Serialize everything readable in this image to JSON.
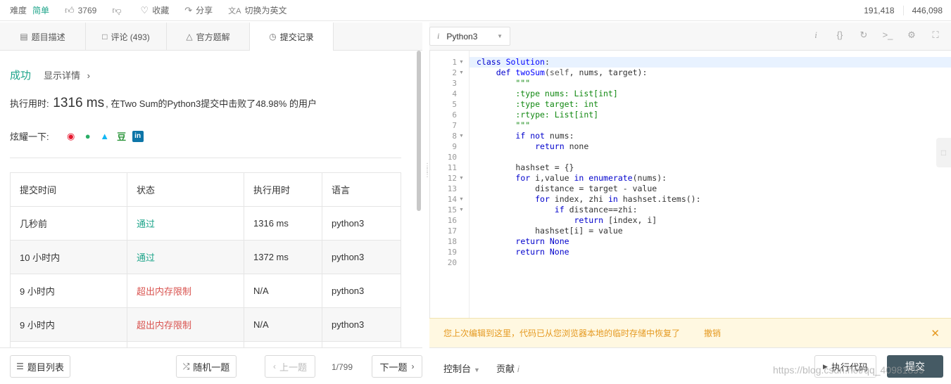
{
  "topbar": {
    "difficulty_label": "难度",
    "difficulty_value": "简单",
    "likes": "3769",
    "favorite": "收藏",
    "share": "分享",
    "switch_lang": "切换为英文",
    "stat1": "191,418",
    "stat2": "446,098"
  },
  "tabs": [
    {
      "label": "题目描述",
      "icon": "document-icon"
    },
    {
      "label": "评论 (493)",
      "icon": "comment-icon"
    },
    {
      "label": "官方题解",
      "icon": "flask-icon"
    },
    {
      "label": "提交记录",
      "icon": "clock-icon",
      "active": true
    }
  ],
  "result": {
    "status": "成功",
    "details": "显示详情",
    "runtime_prefix": "执行用时:",
    "runtime_value": "1316 ms",
    "runtime_suffix": ", 在Two Sum的Python3提交中击败了48.98% 的用户",
    "share_label": "炫耀一下:"
  },
  "share_icons": [
    "weibo-icon",
    "wechat-icon",
    "qq-icon",
    "douban-icon",
    "linkedin-icon"
  ],
  "submissions": {
    "headers": [
      "提交时间",
      "状态",
      "执行用时",
      "语言"
    ],
    "rows": [
      {
        "time": "几秒前",
        "status": "通过",
        "ok": true,
        "runtime": "1316 ms",
        "lang": "python3"
      },
      {
        "time": "10 小时内",
        "status": "通过",
        "ok": true,
        "runtime": "1372 ms",
        "lang": "python3"
      },
      {
        "time": "9 小时内",
        "status": "超出内存限制",
        "ok": false,
        "runtime": "N/A",
        "lang": "python3"
      },
      {
        "time": "9 小时内",
        "status": "超出内存限制",
        "ok": false,
        "runtime": "N/A",
        "lang": "python3"
      }
    ]
  },
  "footer_left": {
    "problem_list": "题目列表",
    "random": "随机一题",
    "prev": "上一题",
    "page": "1/799",
    "next": "下一题"
  },
  "editor": {
    "language": "Python3",
    "lines": [
      "class Solution:",
      "    def twoSum(self, nums, target):",
      "        \"\"\"",
      "        :type nums: List[int]",
      "        :type target: int",
      "        :rtype: List[int]",
      "        \"\"\"",
      "        if not nums:",
      "            return none",
      "",
      "        hashset = {}",
      "        for i,value in enumerate(nums):",
      "            distance = target - value",
      "            for index, zhi in hashset.items():",
      "                if distance==zhi:",
      "                    return [index, i]",
      "            hashset[i] = value",
      "        return None",
      "        return None",
      ""
    ],
    "fold_lines": [
      1,
      2,
      8,
      12,
      14,
      15
    ]
  },
  "restore": {
    "message": "您上次编辑到这里，代码已从您浏览器本地的临时存储中恢复了",
    "undo": "撤销"
  },
  "footer_right": {
    "console": "控制台",
    "contribute": "贡献",
    "run": "执行代码",
    "submit": "提交"
  },
  "watermark": "https://blog.csdn.net/qq_40981899"
}
